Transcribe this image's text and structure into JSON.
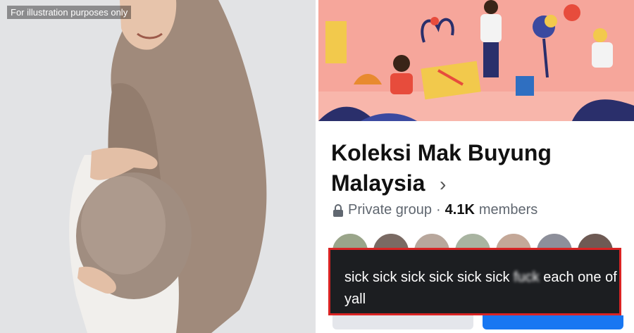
{
  "photo": {
    "caption": "For illustration purposes only"
  },
  "group": {
    "name": "Koleksi Mak Buyung Malaysia",
    "privacy": "Private group",
    "separator": "·",
    "member_count": "4.1K",
    "members_label": "members"
  },
  "comment": {
    "text_before": "sick sick sick sick sick sick ",
    "censored": "fuck",
    "text_after": " each one of yall"
  },
  "colors": {
    "cover_bg": "#f6a69b",
    "comment_border": "#d92323",
    "comment_bg": "#1c1e21",
    "fb_blue": "#1877f2"
  }
}
